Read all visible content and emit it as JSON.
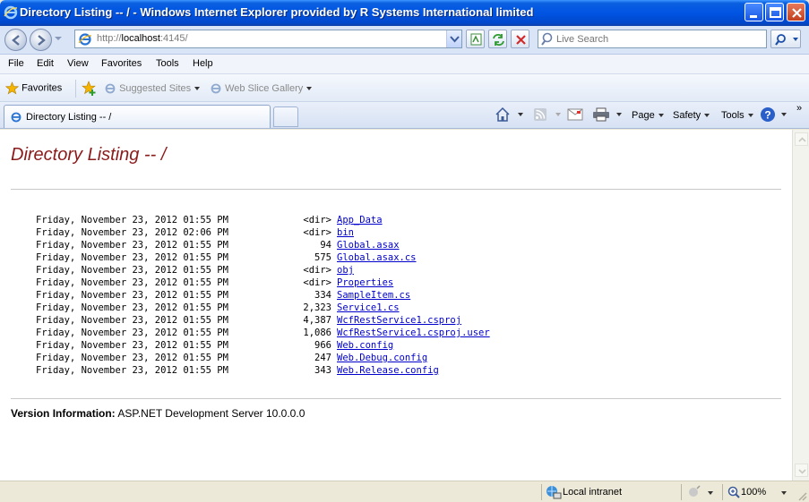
{
  "window": {
    "title": "Directory Listing -- / - Windows Internet Explorer provided by R Systems International limited"
  },
  "address": {
    "url_prefix": "http://",
    "url_host": "localhost",
    "url_rest": ":4145/"
  },
  "search": {
    "placeholder": "Live Search"
  },
  "menu": {
    "items": [
      "File",
      "Edit",
      "View",
      "Favorites",
      "Tools",
      "Help"
    ]
  },
  "favorites_bar": {
    "favorites_label": "Favorites",
    "suggested_sites": "Suggested Sites",
    "web_slice_gallery": "Web Slice Gallery"
  },
  "tabs": {
    "active_label": "Directory Listing -- /"
  },
  "command_bar": {
    "page": "Page",
    "safety": "Safety",
    "tools": "Tools"
  },
  "page": {
    "heading": "Directory Listing -- /",
    "entries": [
      {
        "date": "Friday, November 23, 2012 01:55 PM",
        "size": "<dir>",
        "name": "App_Data"
      },
      {
        "date": "Friday, November 23, 2012 02:06 PM",
        "size": "<dir>",
        "name": "bin"
      },
      {
        "date": "Friday, November 23, 2012 01:55 PM",
        "size": "94",
        "name": "Global.asax"
      },
      {
        "date": "Friday, November 23, 2012 01:55 PM",
        "size": "575",
        "name": "Global.asax.cs"
      },
      {
        "date": "Friday, November 23, 2012 01:55 PM",
        "size": "<dir>",
        "name": "obj"
      },
      {
        "date": "Friday, November 23, 2012 01:55 PM",
        "size": "<dir>",
        "name": "Properties"
      },
      {
        "date": "Friday, November 23, 2012 01:55 PM",
        "size": "334",
        "name": "SampleItem.cs"
      },
      {
        "date": "Friday, November 23, 2012 01:55 PM",
        "size": "2,323",
        "name": "Service1.cs"
      },
      {
        "date": "Friday, November 23, 2012 01:55 PM",
        "size": "4,387",
        "name": "WcfRestService1.csproj"
      },
      {
        "date": "Friday, November 23, 2012 01:55 PM",
        "size": "1,086",
        "name": "WcfRestService1.csproj.user"
      },
      {
        "date": "Friday, November 23, 2012 01:55 PM",
        "size": "966",
        "name": "Web.config"
      },
      {
        "date": "Friday, November 23, 2012 01:55 PM",
        "size": "247",
        "name": "Web.Debug.config"
      },
      {
        "date": "Friday, November 23, 2012 01:55 PM",
        "size": "343",
        "name": "Web.Release.config"
      }
    ],
    "version_label": "Version Information:",
    "version_value": "ASP.NET Development Server 10.0.0.0"
  },
  "status": {
    "zone": "Local intranet",
    "zoom": "100%"
  },
  "colors": {
    "title_bar": "#0054e3",
    "heading": "#8b1a1a",
    "link": "#0000cc"
  }
}
